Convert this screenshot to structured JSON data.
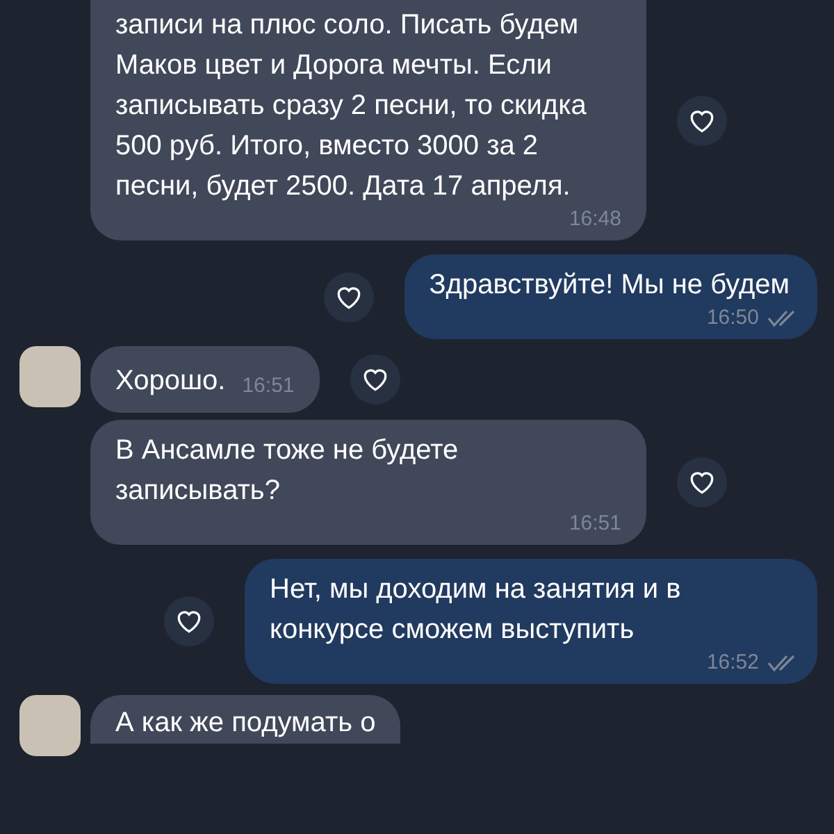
{
  "messages": [
    {
      "kind": "incoming",
      "text": "записи на плюс соло. Писать будем Маков цвет и Дорога мечты. Если записывать сразу 2 песни, то скидка 500 руб. Итого, вместо 3000 за 2 песни, будет 2500. Дата 17 апреля.",
      "time": "16:48",
      "avatar": false,
      "cut_top": true
    },
    {
      "kind": "outgoing",
      "text": "Здравствуйте! Мы не будем",
      "time": "16:50",
      "read": true
    },
    {
      "kind": "incoming",
      "text": "Хорошо.",
      "time": "16:51",
      "avatar": true,
      "inline_time": true
    },
    {
      "kind": "incoming",
      "text": "В Ансамле тоже не будете записывать?",
      "time": "16:51",
      "avatar": false
    },
    {
      "kind": "outgoing",
      "text": "Нет, мы доходим на занятия и в конкурсе сможем выступить",
      "time": "16:52",
      "read": true
    },
    {
      "kind": "incoming",
      "text": "А как же подумать о",
      "avatar": true,
      "cut_bottom": true
    }
  ]
}
